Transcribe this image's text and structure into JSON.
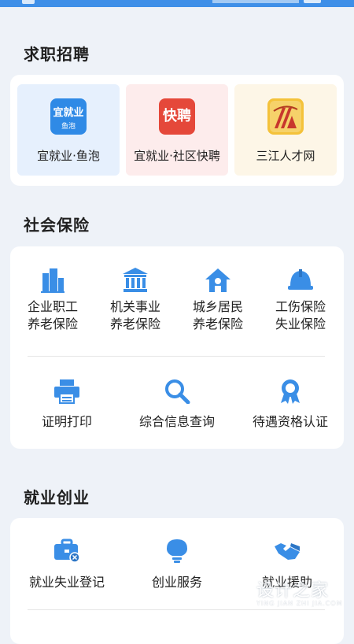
{
  "sections": {
    "recruit": {
      "title": "求职招聘",
      "items": [
        {
          "label": "宜就业·鱼泡",
          "logo_text": "宜就业",
          "logo_sub": "鱼泡",
          "icon": "yijiuye-yupao-logo",
          "bg": "#e6f0fd"
        },
        {
          "label": "宜就业·社区快聘",
          "logo_text": "快聘",
          "icon": "kuaipin-logo",
          "bg": "#fdecec"
        },
        {
          "label": "三江人才网",
          "icon": "sanjiang-logo",
          "bg": "#fdf6e7"
        }
      ]
    },
    "insurance": {
      "title": "社会保险",
      "items": [
        {
          "line1": "企业职工",
          "line2": "养老保险",
          "icon": "building-icon"
        },
        {
          "line1": "机关事业",
          "line2": "养老保险",
          "icon": "institution-icon"
        },
        {
          "line1": "城乡居民",
          "line2": "养老保险",
          "icon": "house-icon"
        },
        {
          "line1": "工伤保险",
          "line2": "失业保险",
          "icon": "helmet-icon"
        }
      ],
      "items2": [
        {
          "label": "证明打印",
          "icon": "printer-icon"
        },
        {
          "label": "综合信息查询",
          "icon": "search-icon"
        },
        {
          "label": "待遇资格认证",
          "icon": "badge-icon"
        }
      ]
    },
    "employment": {
      "title": "就业创业",
      "items": [
        {
          "label": "就业失业登记",
          "icon": "briefcase-icon"
        },
        {
          "label": "创业服务",
          "icon": "lightbulb-icon"
        },
        {
          "label": "就业援助",
          "icon": "handshake-icon"
        }
      ]
    }
  },
  "watermark": {
    "text": "设计之家",
    "sub": "YING JIAN ZHI JIA.COM"
  },
  "colors": {
    "accent": "#2f8ae6",
    "icon_blue": "#3a8ee6",
    "background": "#eef2f8"
  }
}
